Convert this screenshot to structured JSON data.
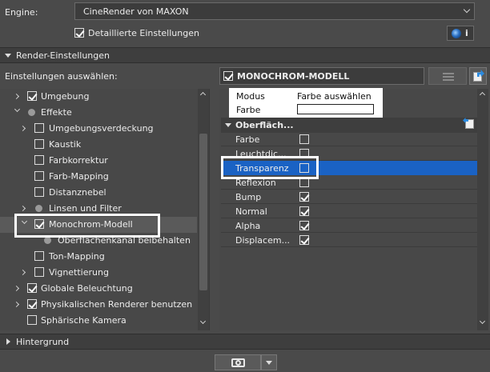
{
  "engine": {
    "label": "Engine:",
    "value": "CineRender von MAXON"
  },
  "detailed_settings": {
    "label": "Detaillierte Einstellungen",
    "checked": true
  },
  "render_section": {
    "title": "Render-Einstellungen"
  },
  "select_settings_label": "Einstellungen auswählen:",
  "selected_effect": {
    "label": "MONOCHROM-MODELL",
    "checked": true
  },
  "tree": [
    {
      "label": "Umgebung",
      "checked": true
    },
    {
      "label": "Effekte"
    },
    {
      "label": "Umgebungsverdeckung",
      "checked": false
    },
    {
      "label": "Kaustik",
      "checked": false
    },
    {
      "label": "Farbkorrektur",
      "checked": false
    },
    {
      "label": "Farb-Mapping",
      "checked": false
    },
    {
      "label": "Distanznebel",
      "checked": false
    },
    {
      "label": "Linsen und Filter"
    },
    {
      "label": "Monochrom-Modell",
      "checked": true
    },
    {
      "label": "Oberflächenkanal beibehalten"
    },
    {
      "label": "Ton-Mapping",
      "checked": false
    },
    {
      "label": "Vignettierung",
      "checked": false
    },
    {
      "label": "Globale Beleuchtung",
      "checked": true
    },
    {
      "label": "Physikalischen Renderer benutzen",
      "checked": true
    },
    {
      "label": "Sphärische Kamera",
      "checked": false
    }
  ],
  "properties": {
    "modus_label": "Modus",
    "modus_value": "Farbe auswählen",
    "farbe_label": "Farbe",
    "surface_group": "Oberfläch...",
    "channels": [
      {
        "label": "Farbe",
        "checked": false
      },
      {
        "label": "Leuchtdic...",
        "checked": false
      },
      {
        "label": "Transparenz",
        "checked": false
      },
      {
        "label": "Reflexion",
        "checked": false
      },
      {
        "label": "Bump",
        "checked": true
      },
      {
        "label": "Normal",
        "checked": true
      },
      {
        "label": "Alpha",
        "checked": true
      },
      {
        "label": "Displacem...",
        "checked": true
      }
    ]
  },
  "background_section": {
    "title": "Hintergrund"
  },
  "colors": {
    "selection": "#1a62c4",
    "panel": "#4a4a4a",
    "highlight_frame": "#ffffff"
  }
}
